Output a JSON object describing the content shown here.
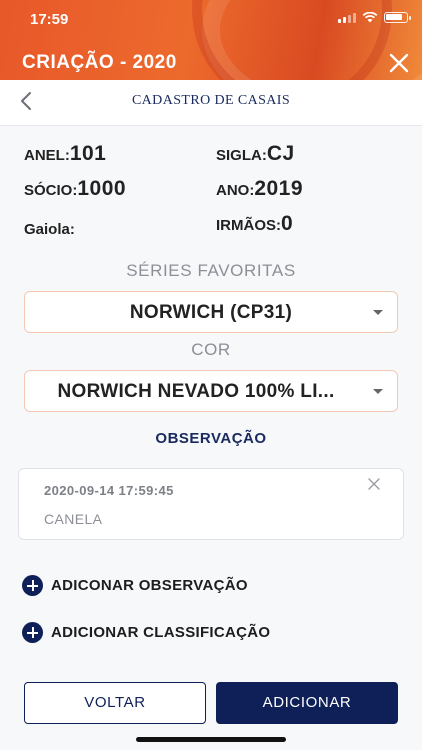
{
  "status_bar": {
    "time": "17:59"
  },
  "header": {
    "title": "CRIAÇÃO - 2020"
  },
  "nav": {
    "title": "CADASTRO DE CASAIS"
  },
  "fields": {
    "anel_label": "ANEL:",
    "anel_value": "101",
    "sigla_label": "SIGLA:",
    "sigla_value": "CJ",
    "socio_label": "SÓCIO:",
    "socio_value": "1000",
    "ano_label": "ANO:",
    "ano_value": "2019",
    "gaiola_label": "Gaiola:",
    "gaiola_value": "",
    "irmaos_label": "IRMÃOS:",
    "irmaos_value": "0"
  },
  "series": {
    "label": "SÉRIES FAVORITAS",
    "selected": "NORWICH (CP31)"
  },
  "cor": {
    "label": "COR",
    "selected": "NORWICH NEVADO 100% LI..."
  },
  "observacao": {
    "title": "OBSERVAÇÃO",
    "entries": [
      {
        "date": "2020-09-14 17:59:45",
        "text": "CANELA"
      }
    ]
  },
  "actions": {
    "add_observation": "ADICONAR OBSERVAÇÃO",
    "add_classification": "ADICIONAR CLASSIFICAÇÃO"
  },
  "buttons": {
    "back": "VOLTAR",
    "add": "ADICIONAR"
  },
  "colors": {
    "brand_orange": "#e8582a",
    "navy": "#0f1f57"
  }
}
